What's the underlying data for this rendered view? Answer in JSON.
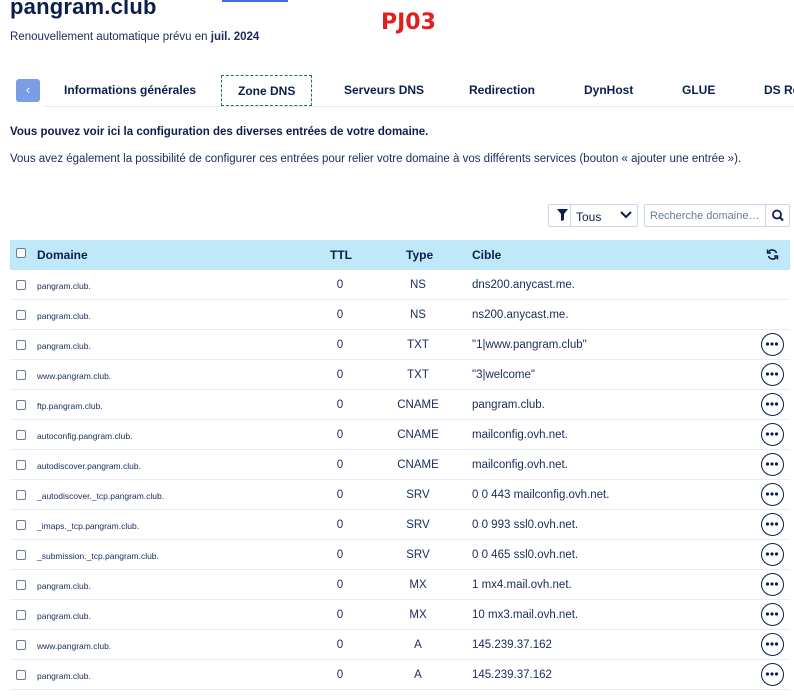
{
  "header": {
    "domain": "pangram.club",
    "annotation": "PJ03",
    "subtitle_prefix": "Renouvellement automatique prévu en",
    "subtitle_date": "juil. 2024"
  },
  "tabs": [
    {
      "label": "Informations générales",
      "active": false
    },
    {
      "label": "Zone DNS",
      "active": true
    },
    {
      "label": "Serveurs DNS",
      "active": false
    },
    {
      "label": "Redirection",
      "active": false
    },
    {
      "label": "DynHost",
      "active": false
    },
    {
      "label": "GLUE",
      "active": false
    },
    {
      "label": "DS Re",
      "active": false
    }
  ],
  "intro": {
    "line1": "Vous pouvez voir ici la configuration des diverses entrées de votre domaine.",
    "line2": "Vous avez également la possibilité de configurer ces entrées pour relier votre domaine à vos différents services (bouton « ajouter une entrée »)."
  },
  "filter": {
    "selected": "Tous"
  },
  "search": {
    "placeholder": "Recherche domaine…"
  },
  "table": {
    "columns": {
      "domain": "Domaine",
      "ttl": "TTL",
      "type": "Type",
      "target": "Cible"
    },
    "rows": [
      {
        "domain": "pangram.club.",
        "ttl": "0",
        "type": "NS",
        "target": "dns200.anycast.me.",
        "actions": false
      },
      {
        "domain": "pangram.club.",
        "ttl": "0",
        "type": "NS",
        "target": "ns200.anycast.me.",
        "actions": false
      },
      {
        "domain": "pangram.club.",
        "ttl": "0",
        "type": "TXT",
        "target": "\"1|www.pangram.club\"",
        "actions": true
      },
      {
        "domain": "www.pangram.club.",
        "ttl": "0",
        "type": "TXT",
        "target": "\"3|welcome\"",
        "actions": true
      },
      {
        "domain": "ftp.pangram.club.",
        "ttl": "0",
        "type": "CNAME",
        "target": "pangram.club.",
        "actions": true
      },
      {
        "domain": "autoconfig.pangram.club.",
        "ttl": "0",
        "type": "CNAME",
        "target": "mailconfig.ovh.net.",
        "actions": true
      },
      {
        "domain": "autodiscover.pangram.club.",
        "ttl": "0",
        "type": "CNAME",
        "target": "mailconfig.ovh.net.",
        "actions": true
      },
      {
        "domain": "_autodiscover._tcp.pangram.club.",
        "ttl": "0",
        "type": "SRV",
        "target": "0 0 443 mailconfig.ovh.net.",
        "actions": true
      },
      {
        "domain": "_imaps._tcp.pangram.club.",
        "ttl": "0",
        "type": "SRV",
        "target": "0 0 993 ssl0.ovh.net.",
        "actions": true
      },
      {
        "domain": "_submission._tcp.pangram.club.",
        "ttl": "0",
        "type": "SRV",
        "target": "0 0 465 ssl0.ovh.net.",
        "actions": true
      },
      {
        "domain": "pangram.club.",
        "ttl": "0",
        "type": "MX",
        "target": "1 mx4.mail.ovh.net.",
        "actions": true
      },
      {
        "domain": "pangram.club.",
        "ttl": "0",
        "type": "MX",
        "target": "10 mx3.mail.ovh.net.",
        "actions": true
      },
      {
        "domain": "www.pangram.club.",
        "ttl": "0",
        "type": "A",
        "target": "145.239.37.162",
        "actions": true
      },
      {
        "domain": "pangram.club.",
        "ttl": "0",
        "type": "A",
        "target": "145.239.37.162",
        "actions": true
      }
    ]
  },
  "colors": {
    "primary": "#0c1e4d",
    "header_bg": "#bfe9f8",
    "accent": "#e0201f",
    "active_tab_border": "#1e7a3c"
  },
  "icons": {
    "back": "chevron-left-icon",
    "filter": "filter-icon",
    "search": "search-icon",
    "refresh": "refresh-icon",
    "more": "more-actions-icon"
  }
}
